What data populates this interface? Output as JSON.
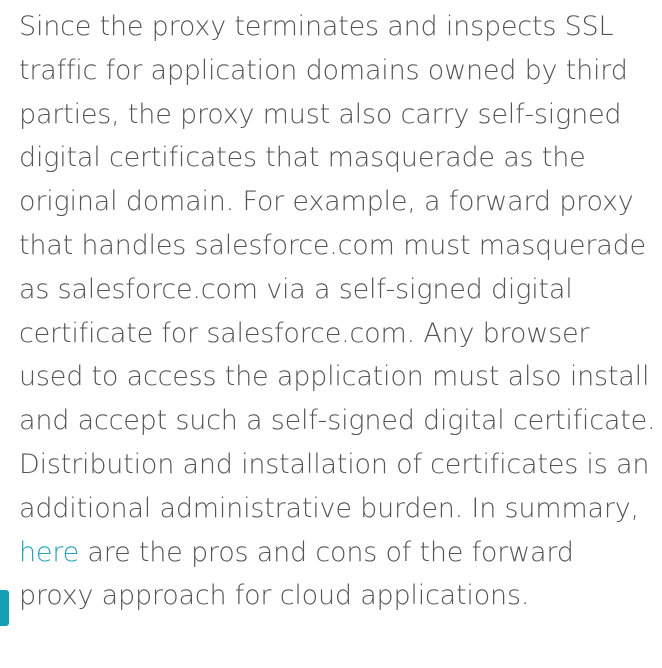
{
  "content": {
    "lines": [
      "Since the proxy terminates and inspects SSL",
      "traffic for application domains owned by third",
      "parties, the proxy must also carry self-signed",
      "digital certificates that masquerade as the",
      "original domain. For example, a forward proxy",
      "that handles salesforce.com must masquerade",
      "as salesforce.com via a self-signed digital",
      "certificate for salesforce.com. Any browser",
      "used to access the application must also install",
      "and accept such a self-signed digital certificate.",
      "Distribution and installation of certificates is an",
      "additional administrative burden. In summary,"
    ],
    "link_text": "here",
    "link_line_rest": " are the pros and cons of the forward",
    "last_line": "proxy approach for cloud applications."
  },
  "colors": {
    "text": "#545454",
    "link": "#1aa6c4",
    "accent": "#12a0b8"
  }
}
